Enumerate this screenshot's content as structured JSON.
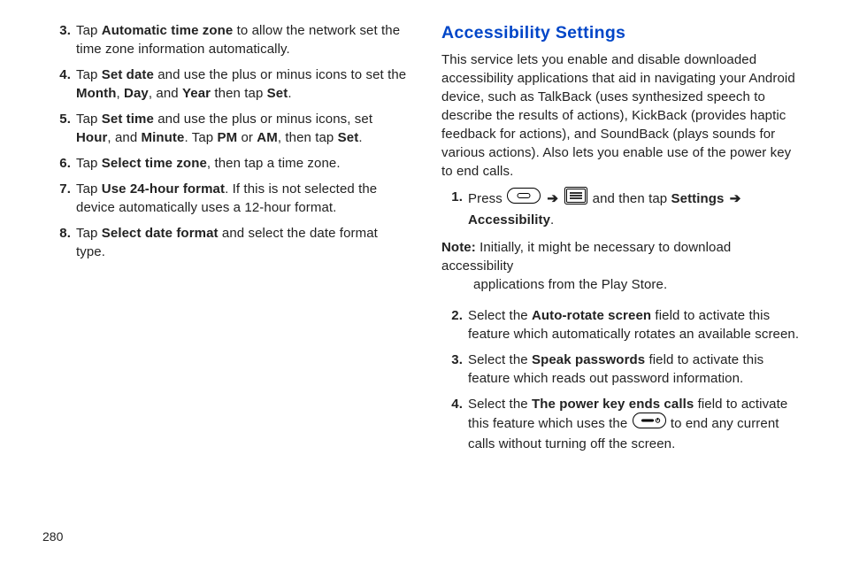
{
  "page_number": "280",
  "left_column": {
    "steps": [
      {
        "n": "3.",
        "segments": [
          {
            "t": "Tap "
          },
          {
            "t": "Automatic time zone",
            "b": true
          },
          {
            "t": " to allow the network set the time zone information automatically."
          }
        ]
      },
      {
        "n": "4.",
        "segments": [
          {
            "t": "Tap "
          },
          {
            "t": "Set date",
            "b": true
          },
          {
            "t": " and use the plus or minus icons to set the "
          },
          {
            "t": "Month",
            "b": true
          },
          {
            "t": ", "
          },
          {
            "t": "Day",
            "b": true
          },
          {
            "t": ", and "
          },
          {
            "t": "Year",
            "b": true
          },
          {
            "t": " then tap "
          },
          {
            "t": "Set",
            "b": true
          },
          {
            "t": "."
          }
        ]
      },
      {
        "n": "5.",
        "segments": [
          {
            "t": "Tap "
          },
          {
            "t": "Set time",
            "b": true
          },
          {
            "t": " and use the plus or minus icons, set "
          },
          {
            "t": "Hour",
            "b": true
          },
          {
            "t": ", and "
          },
          {
            "t": "Minute",
            "b": true
          },
          {
            "t": ". Tap "
          },
          {
            "t": "PM",
            "b": true
          },
          {
            "t": " or "
          },
          {
            "t": "AM",
            "b": true
          },
          {
            "t": ", then tap "
          },
          {
            "t": "Set",
            "b": true
          },
          {
            "t": "."
          }
        ]
      },
      {
        "n": "6.",
        "segments": [
          {
            "t": "Tap "
          },
          {
            "t": "Select time zone",
            "b": true
          },
          {
            "t": ", then tap a time zone."
          }
        ]
      },
      {
        "n": "7.",
        "segments": [
          {
            "t": "Tap "
          },
          {
            "t": "Use 24-hour format",
            "b": true
          },
          {
            "t": ". If this is not selected the device automatically uses a 12-hour format."
          }
        ]
      },
      {
        "n": "8.",
        "segments": [
          {
            "t": "Tap "
          },
          {
            "t": "Select date format",
            "b": true
          },
          {
            "t": " and select the date format type."
          }
        ]
      }
    ]
  },
  "right_column": {
    "title": "Accessibility Settings",
    "intro": "This service lets you enable and disable downloaded accessibility applications that aid in navigating your Android device, such as TalkBack (uses synthesized speech to describe the results of actions), KickBack (provides haptic feedback for actions), and SoundBack (plays sounds for various actions). Also lets you enable use of the power key to end calls.",
    "step1": {
      "n": "1.",
      "pre": "Press ",
      "mid": " and then tap ",
      "path1": "Settings",
      "arrow": "➔",
      "path2": "Accessibility",
      "tail": "."
    },
    "note_label": "Note:",
    "note_first": " Initially, it might be necessary to download accessibility",
    "note_rest": "applications from the Play Store.",
    "steps_b": [
      {
        "n": "2.",
        "segments": [
          {
            "t": "Select the "
          },
          {
            "t": "Auto-rotate screen",
            "b": true
          },
          {
            "t": " field to activate this feature which automatically rotates an available screen."
          }
        ]
      },
      {
        "n": "3.",
        "segments": [
          {
            "t": "Select the "
          },
          {
            "t": "Speak passwords",
            "b": true
          },
          {
            "t": " field to activate this feature which reads out password information."
          }
        ]
      }
    ],
    "step4": {
      "n": "4.",
      "pre": "Select the ",
      "bold1": "The power key ends calls",
      "mid": " field to activate this feature which uses the ",
      "tail": " to end any current calls without turning off the screen."
    }
  }
}
